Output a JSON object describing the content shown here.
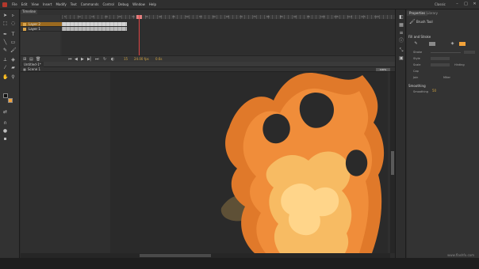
{
  "menu": {
    "items": [
      "File",
      "Edit",
      "View",
      "Insert",
      "Modify",
      "Text",
      "Commands",
      "Control",
      "Debug",
      "Window",
      "Help"
    ],
    "workspace": "Classic"
  },
  "window_controls": {
    "minimize": "–",
    "maximize": "□",
    "close": "✕"
  },
  "timeline": {
    "tab_label": "Timeline",
    "layers": [
      {
        "name": "Layer 2",
        "active": true
      },
      {
        "name": "Layer 1",
        "active": false
      }
    ],
    "ruler_numbers": [
      "5",
      "10",
      "15",
      "20",
      "25",
      "30",
      "35",
      "40",
      "45",
      "50",
      "55",
      "60",
      "65",
      "70",
      "75",
      "80",
      "85",
      "90",
      "95",
      "100",
      "105",
      "110",
      "115",
      "120"
    ],
    "footer": {
      "frame": "15",
      "fps": "24.00 fps",
      "time": "0.6s"
    }
  },
  "document": {
    "tab_label": "Untitled-1*",
    "scene": "Scene 1",
    "zoom": "100%"
  },
  "properties": {
    "tabs": [
      "Properties",
      "Library"
    ],
    "tool_name": "Brush Tool",
    "fill_stroke_section": "Fill and Stroke",
    "fields": [
      "Stroke",
      "Style",
      "Scale",
      "Cap",
      "Join"
    ],
    "hinting_label": "Hinting",
    "miter_label": "Miter",
    "smoothing_section": "Smoothing",
    "smoothing_label": "Smoothing",
    "smoothing_value": "50"
  },
  "colors": {
    "fill_dark": "#e0792a",
    "fill_mid": "#f08d3a",
    "fill_light": "#f7bb63",
    "fill_pale": "#ffd58a",
    "smoke": "#6b5a3a",
    "accent": "#e5a92f",
    "stroke_chip": "#8a8a8a",
    "fill_chip": "#f2a23a"
  },
  "watermark": "www.flashfx.com"
}
